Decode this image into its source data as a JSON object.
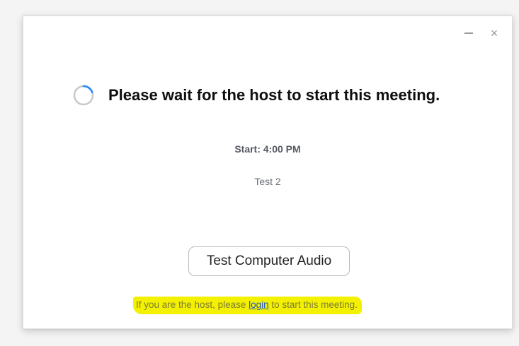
{
  "window": {
    "minimize_icon": "minimize-icon",
    "close_icon": "close-icon",
    "close_glyph": "×"
  },
  "waiting": {
    "spinner_icon": "loading-spinner-icon",
    "title": "Please wait for the host to start this meeting."
  },
  "meeting": {
    "start_time": "Start: 4:00 PM",
    "name": "Test 2"
  },
  "audio_button": {
    "label": "Test Computer Audio"
  },
  "host_note": {
    "before_link": "If you are the host, please ",
    "link_text": "login",
    "after_link": " to start this meeting."
  },
  "colors": {
    "highlight": "#f4f100",
    "link": "#1f54c8",
    "spinner": "#2d8cff"
  }
}
